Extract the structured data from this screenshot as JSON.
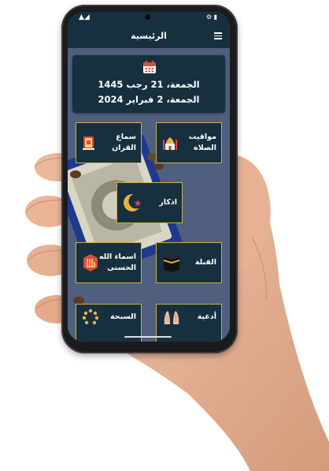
{
  "status_bar": {
    "left": "▲◢",
    "right": "⚙ ▮"
  },
  "header": {
    "title": "الرئيسية",
    "menu_icon": "hamburger-menu-icon"
  },
  "date_card": {
    "icon": "calendar-icon",
    "hijri_date": "الجمعة، 21 رجب 1445",
    "gregorian_date": "الجمعة، 2 فبراير 2024"
  },
  "tiles": {
    "prayer_times": {
      "label_1": "مواقيت",
      "label_2": "الصلاة",
      "icon": "mosque-icon"
    },
    "quran_audio": {
      "label_1": "سماع",
      "label_2": "القران",
      "icon": "quran-book-icon"
    },
    "adhkar": {
      "label_1": "اذكار",
      "icon": "crescent-star-icon"
    },
    "qibla": {
      "label_1": "القبلة",
      "icon": "kaaba-icon"
    },
    "asma_allah": {
      "label_1": "اسماء الله",
      "label_2": "الحسنى",
      "icon": "allah-calligraphy-icon"
    },
    "tasbih": {
      "label_1": "السبحة",
      "icon": "prayer-beads-icon"
    },
    "duas": {
      "label_1": "أدعية",
      "icon": "praying-hands-icon"
    }
  },
  "colors": {
    "tile_bg": "#17303f",
    "tile_border": "#c9b04a",
    "accent_gold": "#e8b341",
    "calendar_red": "#e04b3a"
  }
}
